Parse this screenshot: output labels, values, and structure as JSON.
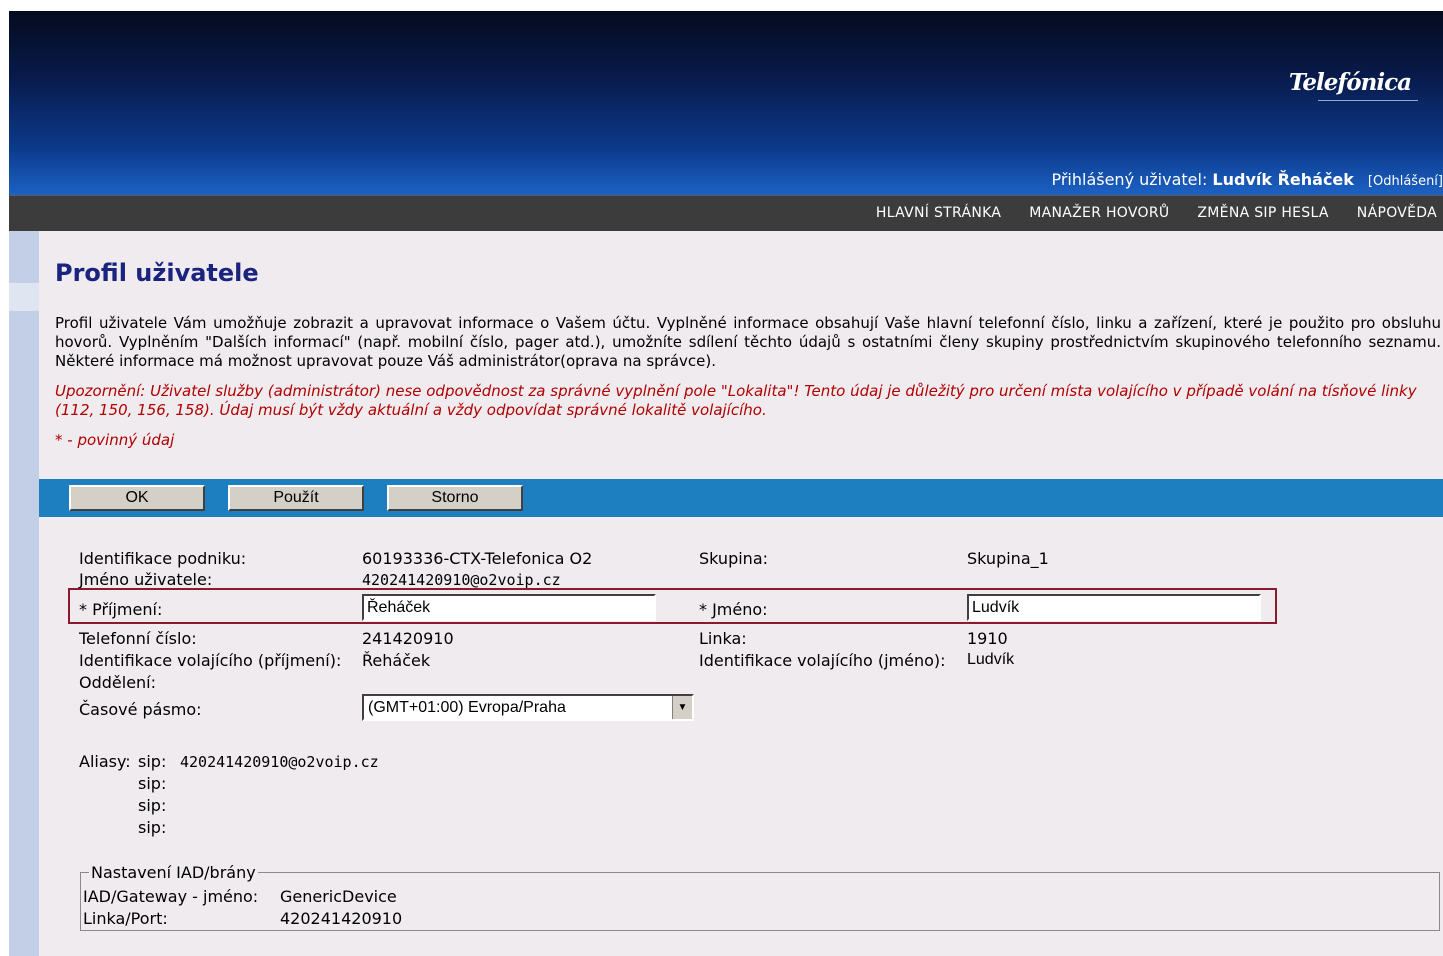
{
  "header": {
    "brand": "Telefónica",
    "user_label": "Přihlášený uživatel: ",
    "user_name": "Ludvík Řeháček",
    "logout": "[Odhlášení]"
  },
  "nav": {
    "items": [
      {
        "label": "HLAVNÍ STRÁNKA"
      },
      {
        "label": "MANAŽER HOVORŮ"
      },
      {
        "label": "ZMĚNA SIP HESLA"
      },
      {
        "label": "NÁPOVĚDA"
      }
    ]
  },
  "page": {
    "title": "Profil uživatele",
    "description": "Profil uživatele Vám umožňuje zobrazit a upravovat informace o Vašem účtu. Vyplněné informace obsahují Vaše hlavní telefonní číslo, linku a zařízení, které je použito pro obsluhu hovorů. Vyplněním \"Dalších informací\" (např. mobilní číslo, pager atd.), umožníte sdílení těchto údajů s ostatními členy skupiny prostřednictvím skupinového telefonního seznamu. Některé informace má možnost upravovat pouze Váš administrátor(oprava na správce).",
    "warning": "Upozornění: Uživatel služby (administrátor) nese odpovědnost za správné vyplnění pole \"Lokalita\"! Tento údaj je důležitý pro určení místa volajícího v případě volání na tísňové linky (112, 150, 156, 158). Údaj musí být vždy aktuální a vždy odpovídat správné lokalitě volajícího.",
    "required_note": "* - povinný údaj"
  },
  "buttons": {
    "ok": "OK",
    "apply": "Použít",
    "cancel": "Storno"
  },
  "form": {
    "enterprise_label": "Identifikace podniku:",
    "enterprise_value": "60193336-CTX-Telefonica  O2",
    "group_label": "Skupina:",
    "group_value": "Skupina_1",
    "username_label": "Jméno uživatele:",
    "username_value": "420241420910@o2voip.cz",
    "surname_label": "* Příjmení:",
    "surname_value": "Řeháček",
    "firstname_label": "* Jméno:",
    "firstname_value": "Ludvík",
    "phone_label": "Telefonní číslo:",
    "phone_value": "241420910",
    "line_label": "Linka:",
    "line_value": "1910",
    "callerid_surname_label": "Identifikace volajícího (příjmení):",
    "callerid_surname_value": "Řeháček",
    "callerid_name_label": "Identifikace volajícího (jméno):",
    "callerid_name_value": "Ludvík",
    "department_label": "Oddělení:",
    "timezone_label": "Časové pásmo:",
    "timezone_value": "(GMT+01:00) Evropa/Praha",
    "aliases_label": "Aliasy:",
    "alias_prefix": "sip:",
    "alias1": "420241420910@o2voip.cz"
  },
  "iad": {
    "legend": "Nastavení IAD/brány",
    "name_label": "IAD/Gateway - jméno:",
    "name_value": "GenericDevice",
    "port_label": "Linka/Port:",
    "port_value": "420241420910"
  }
}
